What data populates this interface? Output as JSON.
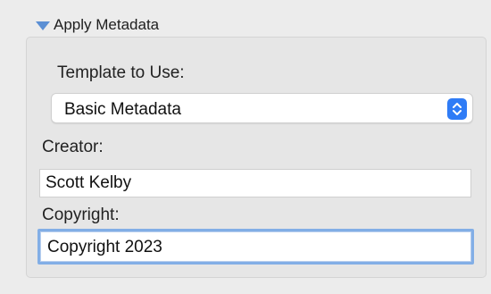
{
  "section": {
    "title": "Apply Metadata"
  },
  "template": {
    "label": "Template to Use:",
    "selected": "Basic Metadata"
  },
  "creator": {
    "label": "Creator:",
    "value": "Scott Kelby"
  },
  "copyright": {
    "label": "Copyright:",
    "value": "Copyright 2023"
  },
  "colors": {
    "accent": "#2f7cf6",
    "focus_ring": "#82aee6",
    "disclosure": "#5b8fd4"
  }
}
